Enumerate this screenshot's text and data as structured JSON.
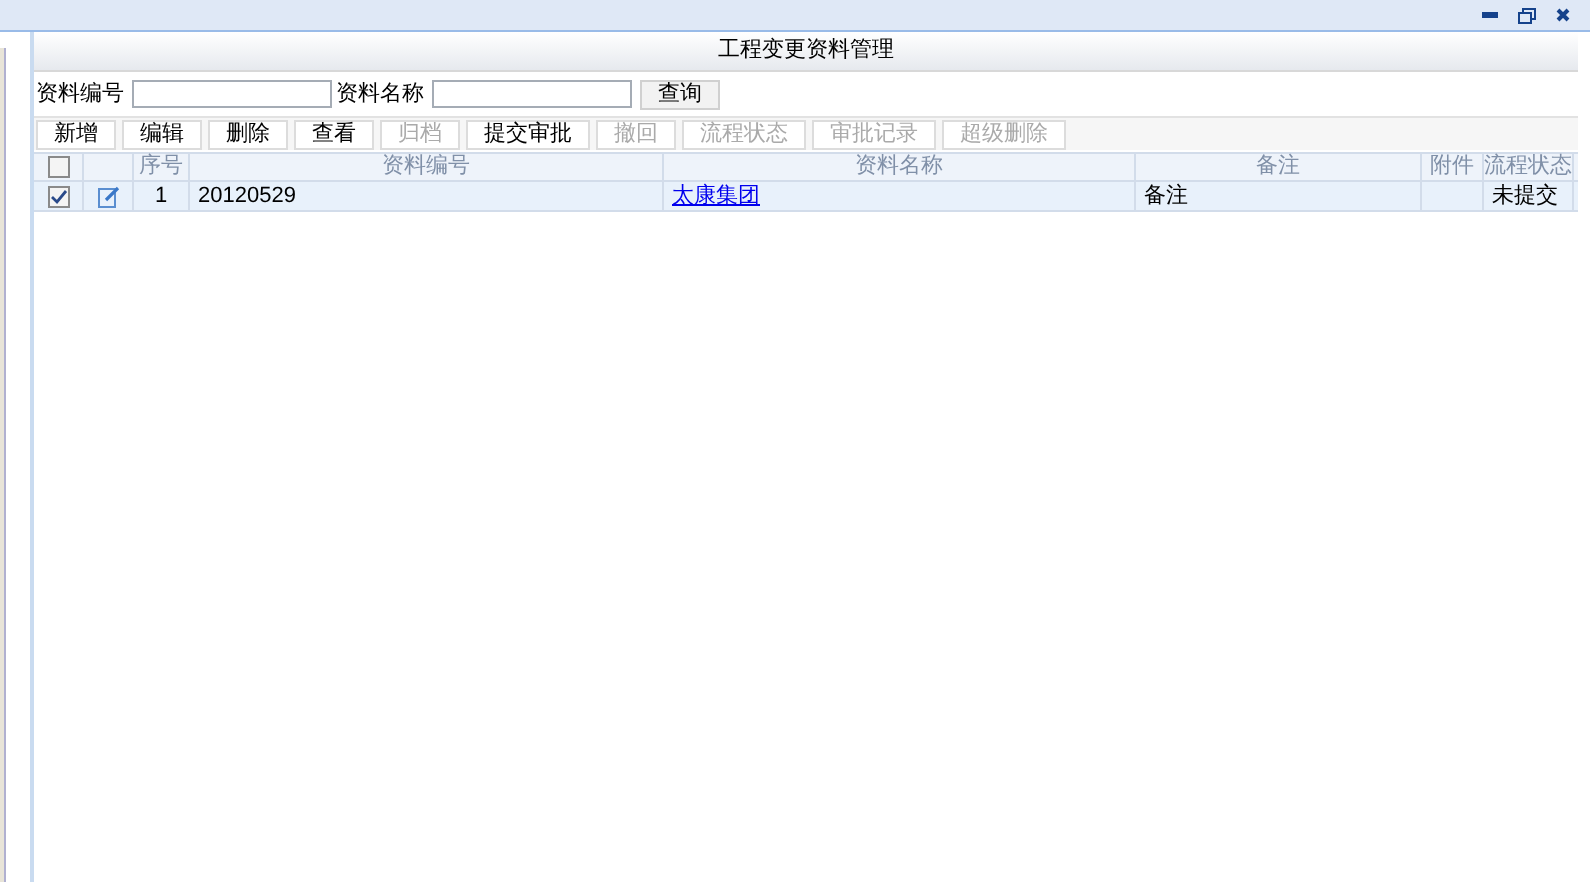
{
  "window": {
    "title": "工程变更资料管理"
  },
  "search": [
    {
      "label": "资料编号"
    },
    {
      "label": "资料名称"
    }
  ],
  "search_button": "查询",
  "toolbar": [
    {
      "label": "新增",
      "disabled": false
    },
    {
      "label": "编辑",
      "disabled": false
    },
    {
      "label": "删除",
      "disabled": false
    },
    {
      "label": "查看",
      "disabled": false
    },
    {
      "label": "归档",
      "disabled": true
    },
    {
      "label": "提交审批",
      "disabled": false
    },
    {
      "label": "撤回",
      "disabled": true
    },
    {
      "label": "流程状态",
      "disabled": true
    },
    {
      "label": "审批记录",
      "disabled": true
    },
    {
      "label": "超级删除",
      "disabled": true
    }
  ],
  "table": {
    "header_checked": false,
    "columns": [
      "序号",
      "资料编号",
      "资料名称",
      "备注",
      "附件",
      "流程状态"
    ],
    "rows": [
      {
        "checked": true,
        "selected": true,
        "cells": [
          "1",
          "20120529",
          "太康集团",
          "备注",
          "",
          "未提交"
        ]
      }
    ]
  }
}
